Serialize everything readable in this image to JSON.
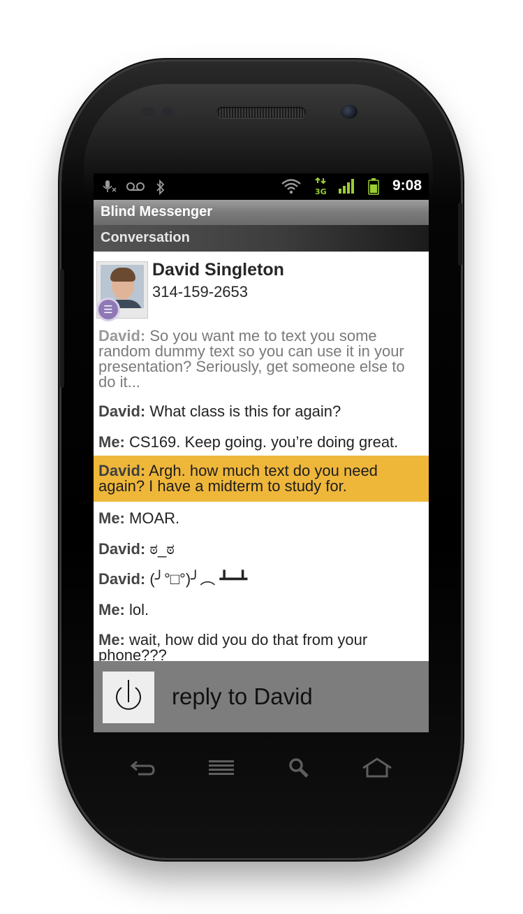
{
  "status_bar": {
    "time": "9:08",
    "network_type": "3G",
    "icons": [
      "mic-muted-icon",
      "voicemail-icon",
      "bluetooth-icon",
      "wifi-icon",
      "data-3g-icon",
      "signal-icon",
      "battery-icon"
    ]
  },
  "app": {
    "title": "Blind Messenger",
    "subtitle": "Conversation"
  },
  "contact": {
    "name": "David Singleton",
    "phone": "314-159-2653"
  },
  "messages": [
    {
      "sender": "David:",
      "text": "So you want me to text you some random dummy text so you can use it in your presentation? Seriously, get someone else to do it...",
      "faded": true
    },
    {
      "sender": "David:",
      "text": "What class is this for again?"
    },
    {
      "sender": "Me:",
      "text": "CS169. Keep going. you’re doing great."
    },
    {
      "sender": "David:",
      "text": "Argh. how much text do you need again? I have a midterm to study for.",
      "highlighted": true
    },
    {
      "sender": "Me:",
      "text": "MOAR."
    },
    {
      "sender": "David:",
      "text": "ಠ_ಠ"
    },
    {
      "sender": "David:",
      "text": "(╯°□°)╯︵ ┻━┻"
    },
    {
      "sender": "Me:",
      "text": "lol."
    },
    {
      "sender": "Me:",
      "text": "wait, how did you do that from your phone???"
    }
  ],
  "reply": {
    "label": "reply to David",
    "icon": "power-icon"
  },
  "soft_keys": [
    "back-icon",
    "menu-icon",
    "search-icon",
    "home-icon"
  ],
  "colors": {
    "highlight": "#efb73a",
    "reply_bar": "#7d7d7d",
    "status_green": "#9acd32"
  }
}
